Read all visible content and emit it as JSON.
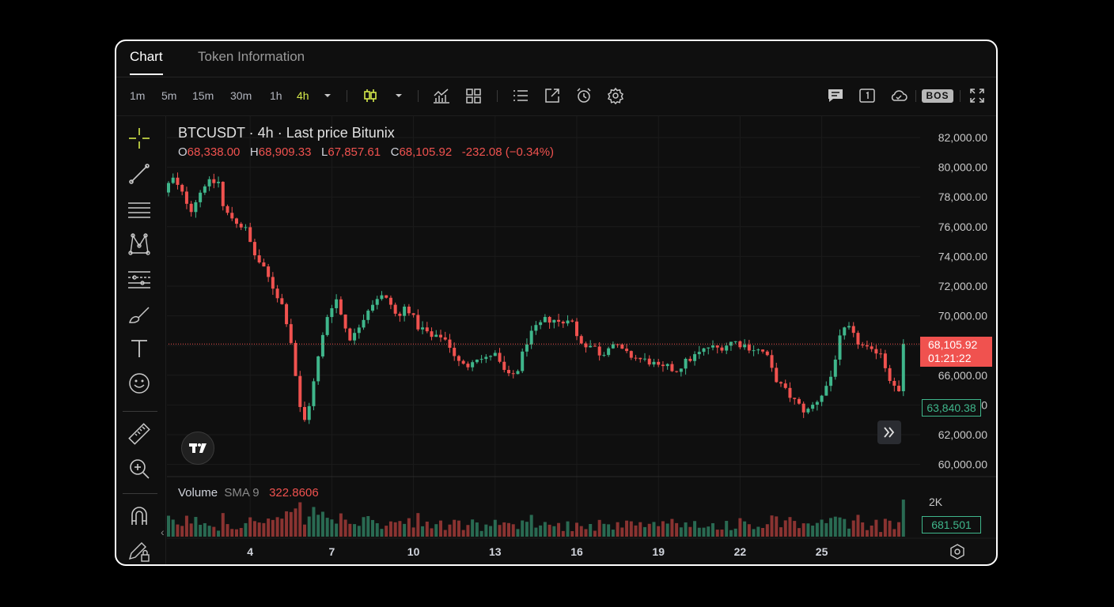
{
  "tabs": [
    {
      "label": "Chart",
      "active": true
    },
    {
      "label": "Token Information",
      "active": false
    }
  ],
  "toolbar": {
    "timeframes": [
      {
        "label": "1m",
        "active": false
      },
      {
        "label": "5m",
        "active": false
      },
      {
        "label": "15m",
        "active": false
      },
      {
        "label": "30m",
        "active": false
      },
      {
        "label": "1h",
        "active": false
      },
      {
        "label": "4h",
        "active": true
      }
    ],
    "icons": [
      "timeframe-dropdown-icon",
      "candles-icon",
      "chart-type-dropdown-icon",
      "indicators-icon",
      "layout-grid-icon",
      "list-icon",
      "external-link-icon",
      "alarm-icon",
      "settings-gear-icon",
      "chat-icon",
      "one-box-icon",
      "cloud-icon",
      "bos-badge",
      "fullscreen-icon"
    ],
    "bos_label": "BOS"
  },
  "legend": {
    "symbol_line": "BTCUSDT · 4h · Last price Bitunix",
    "o_label": "O",
    "o_value": "68,338.00",
    "h_label": "H",
    "h_value": "68,909.33",
    "l_label": "L",
    "l_value": "67,857.61",
    "c_label": "C",
    "c_value": "68,105.92",
    "change": "-232.08 (−0.34%)"
  },
  "volume_legend": {
    "label": "Volume",
    "sma_label": "SMA 9",
    "value": "322.8606"
  },
  "price_tag": {
    "price": "68,105.92",
    "countdown": "01:21:22"
  },
  "low_tag": "63,840.38",
  "volume_tag": "681.501",
  "colors": {
    "up": "#3fb68b",
    "down": "#f0524f",
    "accent": "#d5e94b",
    "background": "#0f0f0f"
  },
  "chart_data": {
    "type": "candlestick",
    "y_ticks": [
      "82,000.00",
      "80,000.00",
      "78,000.00",
      "76,000.00",
      "74,000.00",
      "72,000.00",
      "70,000.00",
      "68,000.00",
      "66,000.00",
      "64,000.00",
      "62,000.00",
      "60,000.00"
    ],
    "y_tick_values": [
      82000,
      80000,
      78000,
      76000,
      74000,
      72000,
      70000,
      68000,
      66000,
      64000,
      62000,
      60000
    ],
    "volume_ticks": [
      "2K"
    ],
    "x_ticks": [
      "4",
      "7",
      "10",
      "13",
      "16",
      "19",
      "22",
      "25"
    ],
    "ylim": [
      59500,
      82500
    ],
    "last_price": 68105.92,
    "grid": true,
    "price_path": [
      [
        1,
        78300
      ],
      [
        1.3,
        79300
      ],
      [
        2,
        77200
      ],
      [
        2.5,
        78900
      ],
      [
        3,
        79000
      ],
      [
        3.2,
        77000
      ],
      [
        3.5,
        76600
      ],
      [
        4,
        75800
      ],
      [
        4.3,
        74200
      ],
      [
        4.7,
        73000
      ],
      [
        5.1,
        71600
      ],
      [
        5.4,
        70500
      ],
      [
        5.7,
        68000
      ],
      [
        5.9,
        65000
      ],
      [
        6.1,
        62500
      ],
      [
        6.4,
        64500
      ],
      [
        6.7,
        67500
      ],
      [
        7,
        70000
      ],
      [
        7.3,
        71300
      ],
      [
        7.6,
        69500
      ],
      [
        7.9,
        68300
      ],
      [
        8.2,
        69500
      ],
      [
        8.5,
        70500
      ],
      [
        8.9,
        71400
      ],
      [
        9.3,
        70900
      ],
      [
        9.6,
        69700
      ],
      [
        9.9,
        70800
      ],
      [
        10.3,
        69300
      ],
      [
        10.6,
        69000
      ],
      [
        10.9,
        68400
      ],
      [
        11.2,
        68700
      ],
      [
        11.5,
        68000
      ],
      [
        11.8,
        66900
      ],
      [
        12.1,
        66500
      ],
      [
        12.4,
        67300
      ],
      [
        12.8,
        67000
      ],
      [
        13.1,
        67600
      ],
      [
        13.4,
        66500
      ],
      [
        13.7,
        65800
      ],
      [
        14,
        66400
      ],
      [
        14.3,
        68200
      ],
      [
        14.6,
        69000
      ],
      [
        15,
        69700
      ],
      [
        15.3,
        69800
      ],
      [
        15.6,
        69400
      ],
      [
        15.9,
        70100
      ],
      [
        16.2,
        68400
      ],
      [
        16.5,
        68100
      ],
      [
        16.8,
        67900
      ],
      [
        17.1,
        67300
      ],
      [
        17.4,
        68300
      ],
      [
        17.7,
        67800
      ],
      [
        18,
        67400
      ],
      [
        18.3,
        67200
      ],
      [
        18.6,
        67000
      ],
      [
        18.9,
        66900
      ],
      [
        19.2,
        66400
      ],
      [
        19.5,
        66500
      ],
      [
        19.8,
        66300
      ],
      [
        20.1,
        66800
      ],
      [
        20.4,
        67200
      ],
      [
        20.7,
        67500
      ],
      [
        21,
        67900
      ],
      [
        21.3,
        67800
      ],
      [
        21.6,
        68000
      ],
      [
        21.9,
        68300
      ],
      [
        22.2,
        68100
      ],
      [
        22.5,
        67900
      ],
      [
        22.8,
        67700
      ],
      [
        23.1,
        67500
      ],
      [
        23.4,
        66000
      ],
      [
        23.7,
        65200
      ],
      [
        24,
        64600
      ],
      [
        24.3,
        64000
      ],
      [
        24.6,
        63500
      ],
      [
        24.9,
        64100
      ],
      [
        25.2,
        64800
      ],
      [
        25.5,
        65900
      ],
      [
        25.8,
        68300
      ],
      [
        26.1,
        69300
      ],
      [
        26.4,
        68400
      ],
      [
        26.7,
        67900
      ],
      [
        27,
        67500
      ],
      [
        27.3,
        67800
      ],
      [
        27.6,
        66000
      ],
      [
        27.9,
        65300
      ],
      [
        28.15,
        64100
      ]
    ]
  }
}
